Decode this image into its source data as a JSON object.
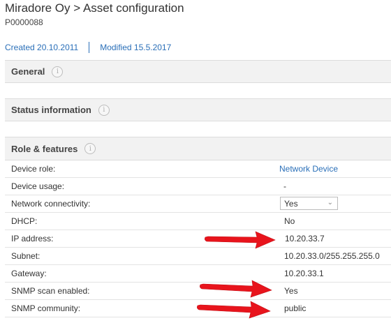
{
  "header": {
    "title": "Miradore Oy > Asset configuration",
    "subtitle": "P0000088",
    "created": "Created 20.10.2011",
    "modified": "Modified 15.5.2017"
  },
  "sections": {
    "general": "General",
    "status": "Status information",
    "role": "Role & features"
  },
  "info_glyph": "i",
  "rows": [
    {
      "label": "Device role:",
      "value": "Network Device"
    },
    {
      "label": "Device usage:",
      "value": "-"
    },
    {
      "label": "Network connectivity:",
      "value": "Yes"
    },
    {
      "label": "DHCP:",
      "value": "No"
    },
    {
      "label": "IP address:",
      "value": "10.20.33.7"
    },
    {
      "label": "Subnet:",
      "value": "10.20.33.0/255.255.255.0"
    },
    {
      "label": "Gateway:",
      "value": "10.20.33.1"
    },
    {
      "label": "SNMP scan enabled:",
      "value": "Yes"
    },
    {
      "label": "SNMP community:",
      "value": "public"
    }
  ],
  "colors": {
    "link": "#2a6fb8",
    "arrow": "#e8141c",
    "section_bg": "#f2f2f2"
  },
  "icons": [
    "info-icon",
    "chevron-down-icon",
    "red-arrow-annotation"
  ]
}
